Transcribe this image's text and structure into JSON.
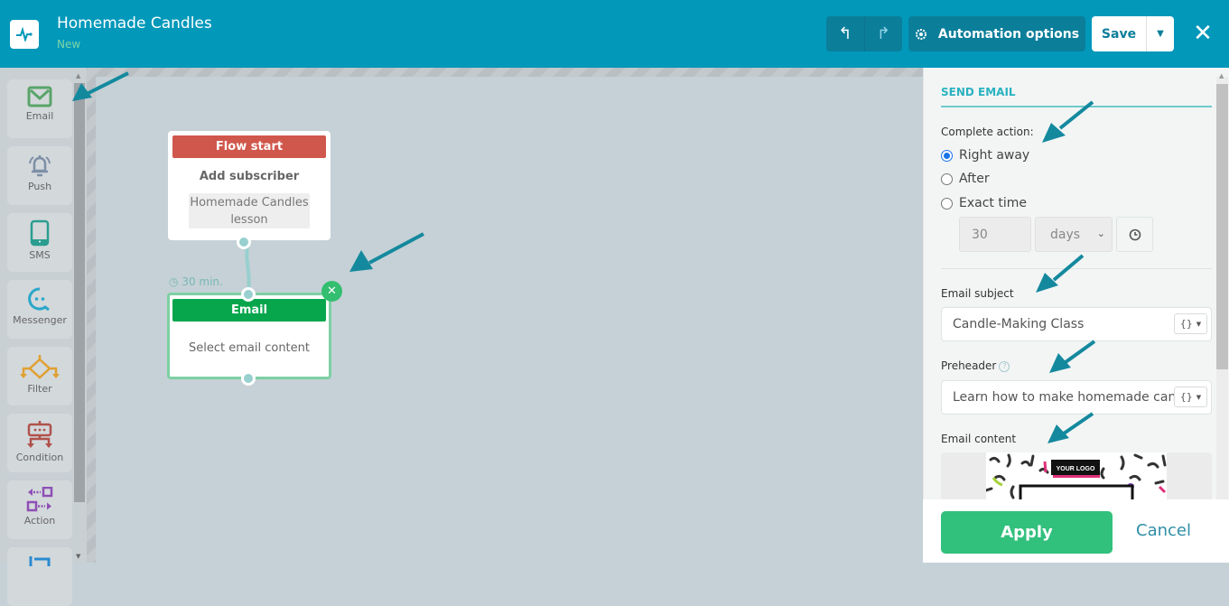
{
  "header": {
    "title": "Homemade Candles",
    "status": "New",
    "undo_icon": "undo-icon",
    "redo_icon": "redo-icon",
    "automation_options_label": "Automation options",
    "save_label": "Save",
    "colors": {
      "bar": "#0198ba",
      "button_dark": "#0b7e9a",
      "status": "#7fd6a8"
    }
  },
  "sidebar": {
    "items": [
      {
        "label": "Email",
        "icon": "envelope-icon",
        "color": "#5aa469"
      },
      {
        "label": "Push",
        "icon": "bell-icon",
        "color": "#7d8fa6"
      },
      {
        "label": "SMS",
        "icon": "phone-icon",
        "color": "#2a9d8f"
      },
      {
        "label": "Messenger",
        "icon": "chat-icon",
        "color": "#2aa7c9"
      },
      {
        "label": "Filter",
        "icon": "filter-icon",
        "color": "#e0a030"
      },
      {
        "label": "Condition",
        "icon": "condition-icon",
        "color": "#b0524b"
      },
      {
        "label": "Action",
        "icon": "action-icon",
        "color": "#8e4fb5"
      }
    ]
  },
  "canvas": {
    "flow_start": {
      "header": "Flow start",
      "title": "Add subscriber",
      "tag": "Homemade Candles lesson"
    },
    "delay_label": "30 min.",
    "email_node": {
      "header": "Email",
      "body": "Select email content"
    }
  },
  "panel": {
    "title": "SEND EMAIL",
    "complete_action_label": "Complete action:",
    "options": [
      {
        "label": "Right away",
        "checked": true
      },
      {
        "label": "After",
        "checked": false
      },
      {
        "label": "Exact time",
        "checked": false
      }
    ],
    "delay_value": "30",
    "delay_unit": "days",
    "email_subject_label": "Email subject",
    "email_subject_value": "Candle-Making Class",
    "preheader_label": "Preheader",
    "preheader_value": "Learn how to make homemade candles",
    "variables_button": "{}",
    "email_content_label": "Email content",
    "preview_logo_text": "YOUR LOGO",
    "apply_label": "Apply",
    "cancel_label": "Cancel"
  }
}
